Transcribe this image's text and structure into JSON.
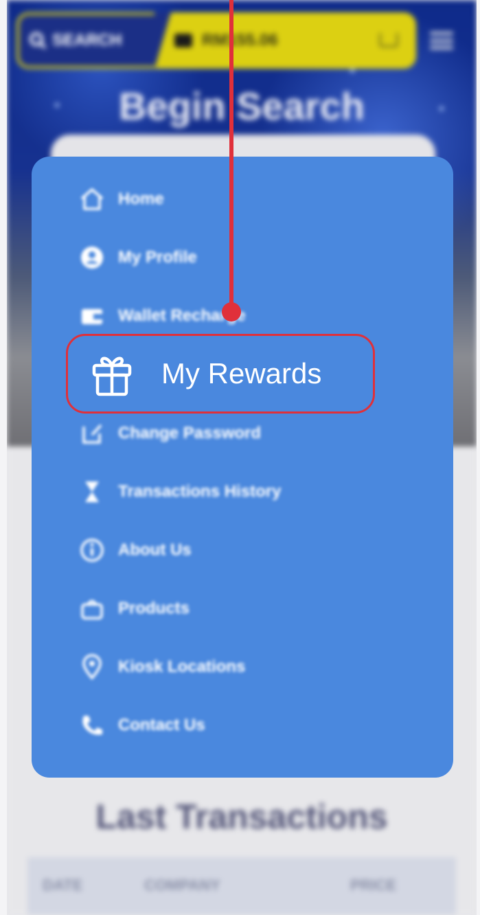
{
  "topbar": {
    "search_label": "SEARCH",
    "balance": "RM155.06",
    "icons": {
      "search": "search-icon",
      "wallet": "wallet-icon",
      "cart": "cart-icon",
      "menu": "hamburger-menu-icon"
    }
  },
  "hero": {
    "title": "Begin Search"
  },
  "drawer": {
    "items": [
      {
        "label": "Home",
        "icon": "home-icon"
      },
      {
        "label": "My Profile",
        "icon": "profile-icon"
      },
      {
        "label": "Wallet Recharge",
        "icon": "wallet-icon"
      },
      {
        "label": "My Rewards",
        "icon": "gift-icon"
      },
      {
        "label": "Change Password",
        "icon": "edit-icon"
      },
      {
        "label": "Transactions History",
        "icon": "hourglass-icon"
      },
      {
        "label": "About Us",
        "icon": "info-icon"
      },
      {
        "label": "Products",
        "icon": "bag-icon"
      },
      {
        "label": "Kiosk Locations",
        "icon": "location-pin-icon"
      },
      {
        "label": "Contact Us",
        "icon": "phone-icon"
      }
    ]
  },
  "transactions": {
    "title": "Last Transactions",
    "columns": [
      "DATE",
      "COMPANY",
      "PRICE"
    ]
  },
  "annotation": {
    "highlight_color": "#e0303a"
  },
  "colors": {
    "drawer_bg": "#4a88de",
    "topbar_yellow": "#dcd012",
    "topbar_navy": "#1b2f86",
    "hero_blue": "#16318f"
  }
}
